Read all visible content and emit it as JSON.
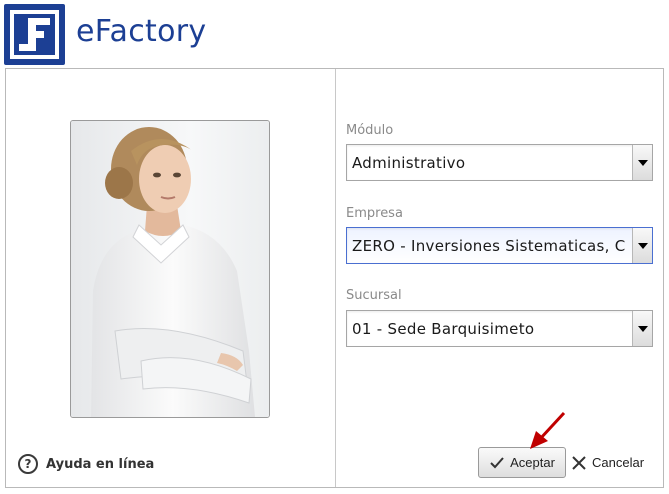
{
  "app": {
    "title": "eFactory"
  },
  "help": {
    "label": "Ayuda en línea"
  },
  "form": {
    "modulo": {
      "label": "Módulo",
      "value": "Administrativo"
    },
    "empresa": {
      "label": "Empresa",
      "value": "ZERO - Inversiones Sistematicas, C"
    },
    "sucursal": {
      "label": "Sucursal",
      "value": "01 - Sede Barquisimeto"
    }
  },
  "buttons": {
    "accept": "Aceptar",
    "cancel": "Cancelar"
  },
  "colors": {
    "brand": "#1c3f94",
    "annotation_arrow": "#c00000"
  }
}
